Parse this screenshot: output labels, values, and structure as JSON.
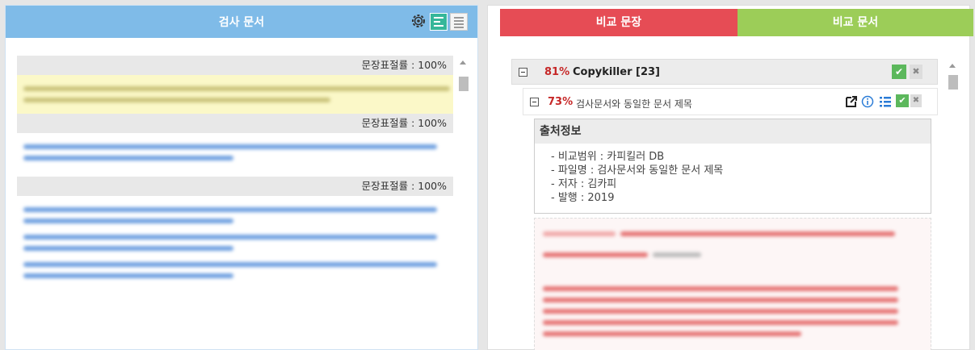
{
  "left": {
    "title": "검사 문서",
    "ratio_label": "문장표절률 : 100%"
  },
  "right": {
    "tab_compare_sentence": "비교 문장",
    "tab_compare_doc": "비교 문서",
    "source": {
      "percent": "81%",
      "name": "Copykiller [23]"
    },
    "sub": {
      "percent": "73%",
      "title": "검사문서와 동일한 문서 제목"
    },
    "info": {
      "title": "출처정보",
      "rows": [
        "- 비교범위 : 카피킬러 DB",
        "- 파일명 :  검사문서와 동일한 문서 제목",
        "- 저자 :  김카피",
        "- 발행 :  2019"
      ]
    }
  },
  "icons": {
    "settings": "gear-icon",
    "view_split": "list-view-icon",
    "view_plain": "lines-view-icon",
    "accept": "check-icon",
    "close": "close-icon",
    "open": "external-link-icon",
    "info": "info-icon",
    "list": "list-icon"
  },
  "colors": {
    "left_header": "#7fbbe8",
    "tab_red": "#e64c55",
    "tab_green": "#9ccd58",
    "percent_red": "#c62828"
  }
}
